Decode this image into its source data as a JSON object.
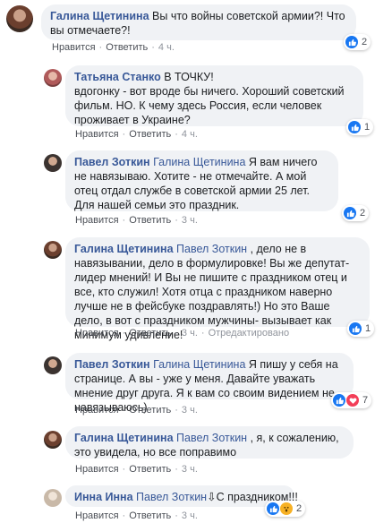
{
  "comments": [
    {
      "author": "Галина Щетинина",
      "text": "Вы что войны советской армии?! Что вы отмечаете?!",
      "like": "Нравится",
      "reply": "Ответить",
      "time": "4 ч.",
      "reactions": "2"
    },
    {
      "author": "Татьяна Станко",
      "text_lead": "В ТОЧКУ!",
      "text": "вдогонку - вот вроде бы ничего. Хороший советский фильм. НО. К чему здесь Россия, если человек проживает в Украине?",
      "like": "Нравится",
      "reply": "Ответить",
      "time": "4 ч.",
      "reactions": "1"
    },
    {
      "author": "Павел Зоткин",
      "mention": "Галина Щетинина",
      "text": "Я вам ничего не навязываю. Хотите - не отмечайте. А мой отец отдал службе в советской армии 25 лет. Для нашей семьи это праздник.",
      "like": "Нравится",
      "reply": "Ответить",
      "time": "3 ч.",
      "reactions": "2"
    },
    {
      "author": "Галина Щетинина",
      "mention": "Павел Зоткин",
      "text": ", дело не в навязывании, дело в формулировке! Вы же депутат- лидер мнений! И Вы не пишите с праздником отец и все, кто служил! Хотя отца с праздником наверно лучше не в фейсбуке поздравлять!) Но это Ваше дело, в вот с праздником мужчины- вызывает как минимум удивление!",
      "like": "Нравится",
      "reply": "Ответить",
      "time": "3 ч.",
      "edited": "Отредактировано",
      "reactions": "1"
    },
    {
      "author": "Павел Зоткин",
      "mention": "Галина Щетинина",
      "text": "Я пишу у себя на странице. А вы - уже у меня. Давайте уважать мнение друг друга. Я к вам со своим видением не навязываюсь)",
      "like": "Нравится",
      "reply": "Ответить",
      "time": "3 ч.",
      "reactions": "7"
    },
    {
      "author": "Галина Щетинина",
      "mention": "Павел Зоткин",
      "text": ", я, к сожалению, это увидела, но все поправимо",
      "like": "Нравится",
      "reply": "Ответить",
      "time": "3 ч."
    },
    {
      "author": "Инна Инна",
      "mention": "Павел Зоткин",
      "text": "С праздником!!!",
      "like": "Нравится",
      "reply": "Ответить",
      "time": "3 ч.",
      "reactions": "2"
    }
  ],
  "colors": {
    "link": "#385898",
    "bubble": "#f0f2f5",
    "meta": "#90949c",
    "like_blue": "#1877f2",
    "love_red": "#f33e58",
    "wow_yellow": "#f7b125"
  },
  "icons": [
    "like-icon",
    "love-icon",
    "wow-icon"
  ]
}
